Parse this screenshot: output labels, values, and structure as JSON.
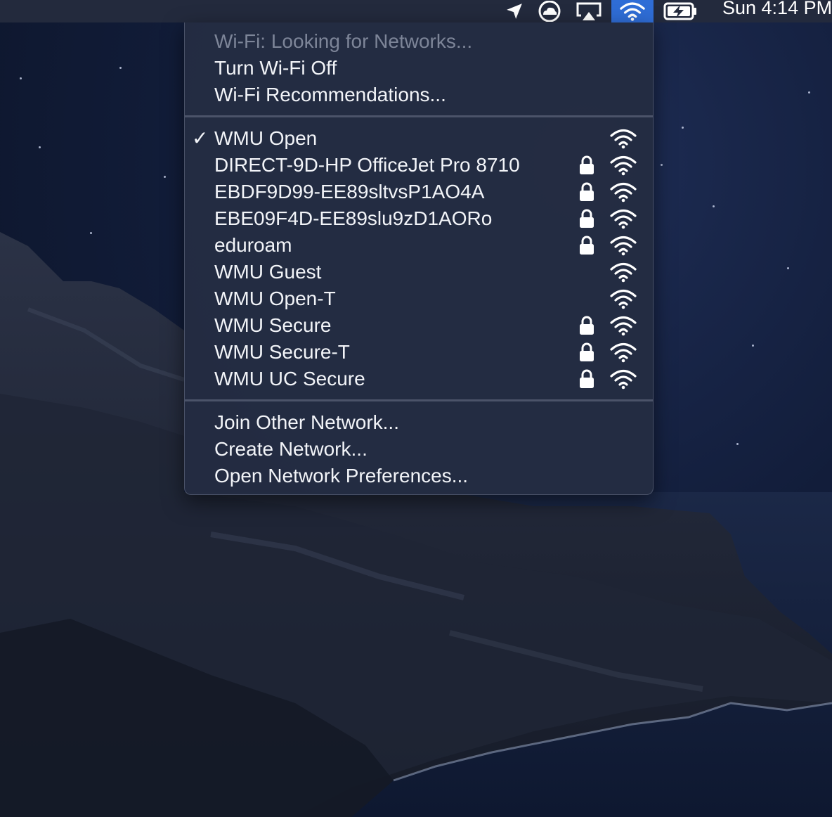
{
  "menubar": {
    "clock": "Sun 4:14 PM",
    "icons": [
      "location-arrow-icon",
      "creative-cloud-icon",
      "airplay-icon",
      "wifi-icon",
      "battery-charging-icon"
    ]
  },
  "wifi_menu": {
    "status": "Wi-Fi: Looking for Networks...",
    "turn_off": "Turn Wi-Fi Off",
    "recommendations": "Wi-Fi Recommendations...",
    "networks": [
      {
        "name": "WMU Open",
        "secured": false,
        "connected": true
      },
      {
        "name": "DIRECT-9D-HP OfficeJet Pro 8710",
        "secured": true,
        "connected": false
      },
      {
        "name": "EBDF9D99-EE89sltvsP1AO4A",
        "secured": true,
        "connected": false
      },
      {
        "name": "EBE09F4D-EE89slu9zD1AORo",
        "secured": true,
        "connected": false
      },
      {
        "name": "eduroam",
        "secured": true,
        "connected": false
      },
      {
        "name": "WMU Guest",
        "secured": false,
        "connected": false
      },
      {
        "name": "WMU Open-T",
        "secured": false,
        "connected": false
      },
      {
        "name": "WMU Secure",
        "secured": true,
        "connected": false
      },
      {
        "name": "WMU Secure-T",
        "secured": true,
        "connected": false
      },
      {
        "name": "WMU UC Secure",
        "secured": true,
        "connected": false
      }
    ],
    "join_other": "Join Other Network...",
    "create": "Create Network...",
    "preferences": "Open Network Preferences...",
    "checkmark": "✓"
  },
  "colors": {
    "menubar": "#232a3d",
    "wifi_highlight": "#2f6dd6",
    "menu_bg": "#242c42",
    "text": "#f2f4f8",
    "disabled_text": "#7d8598"
  }
}
